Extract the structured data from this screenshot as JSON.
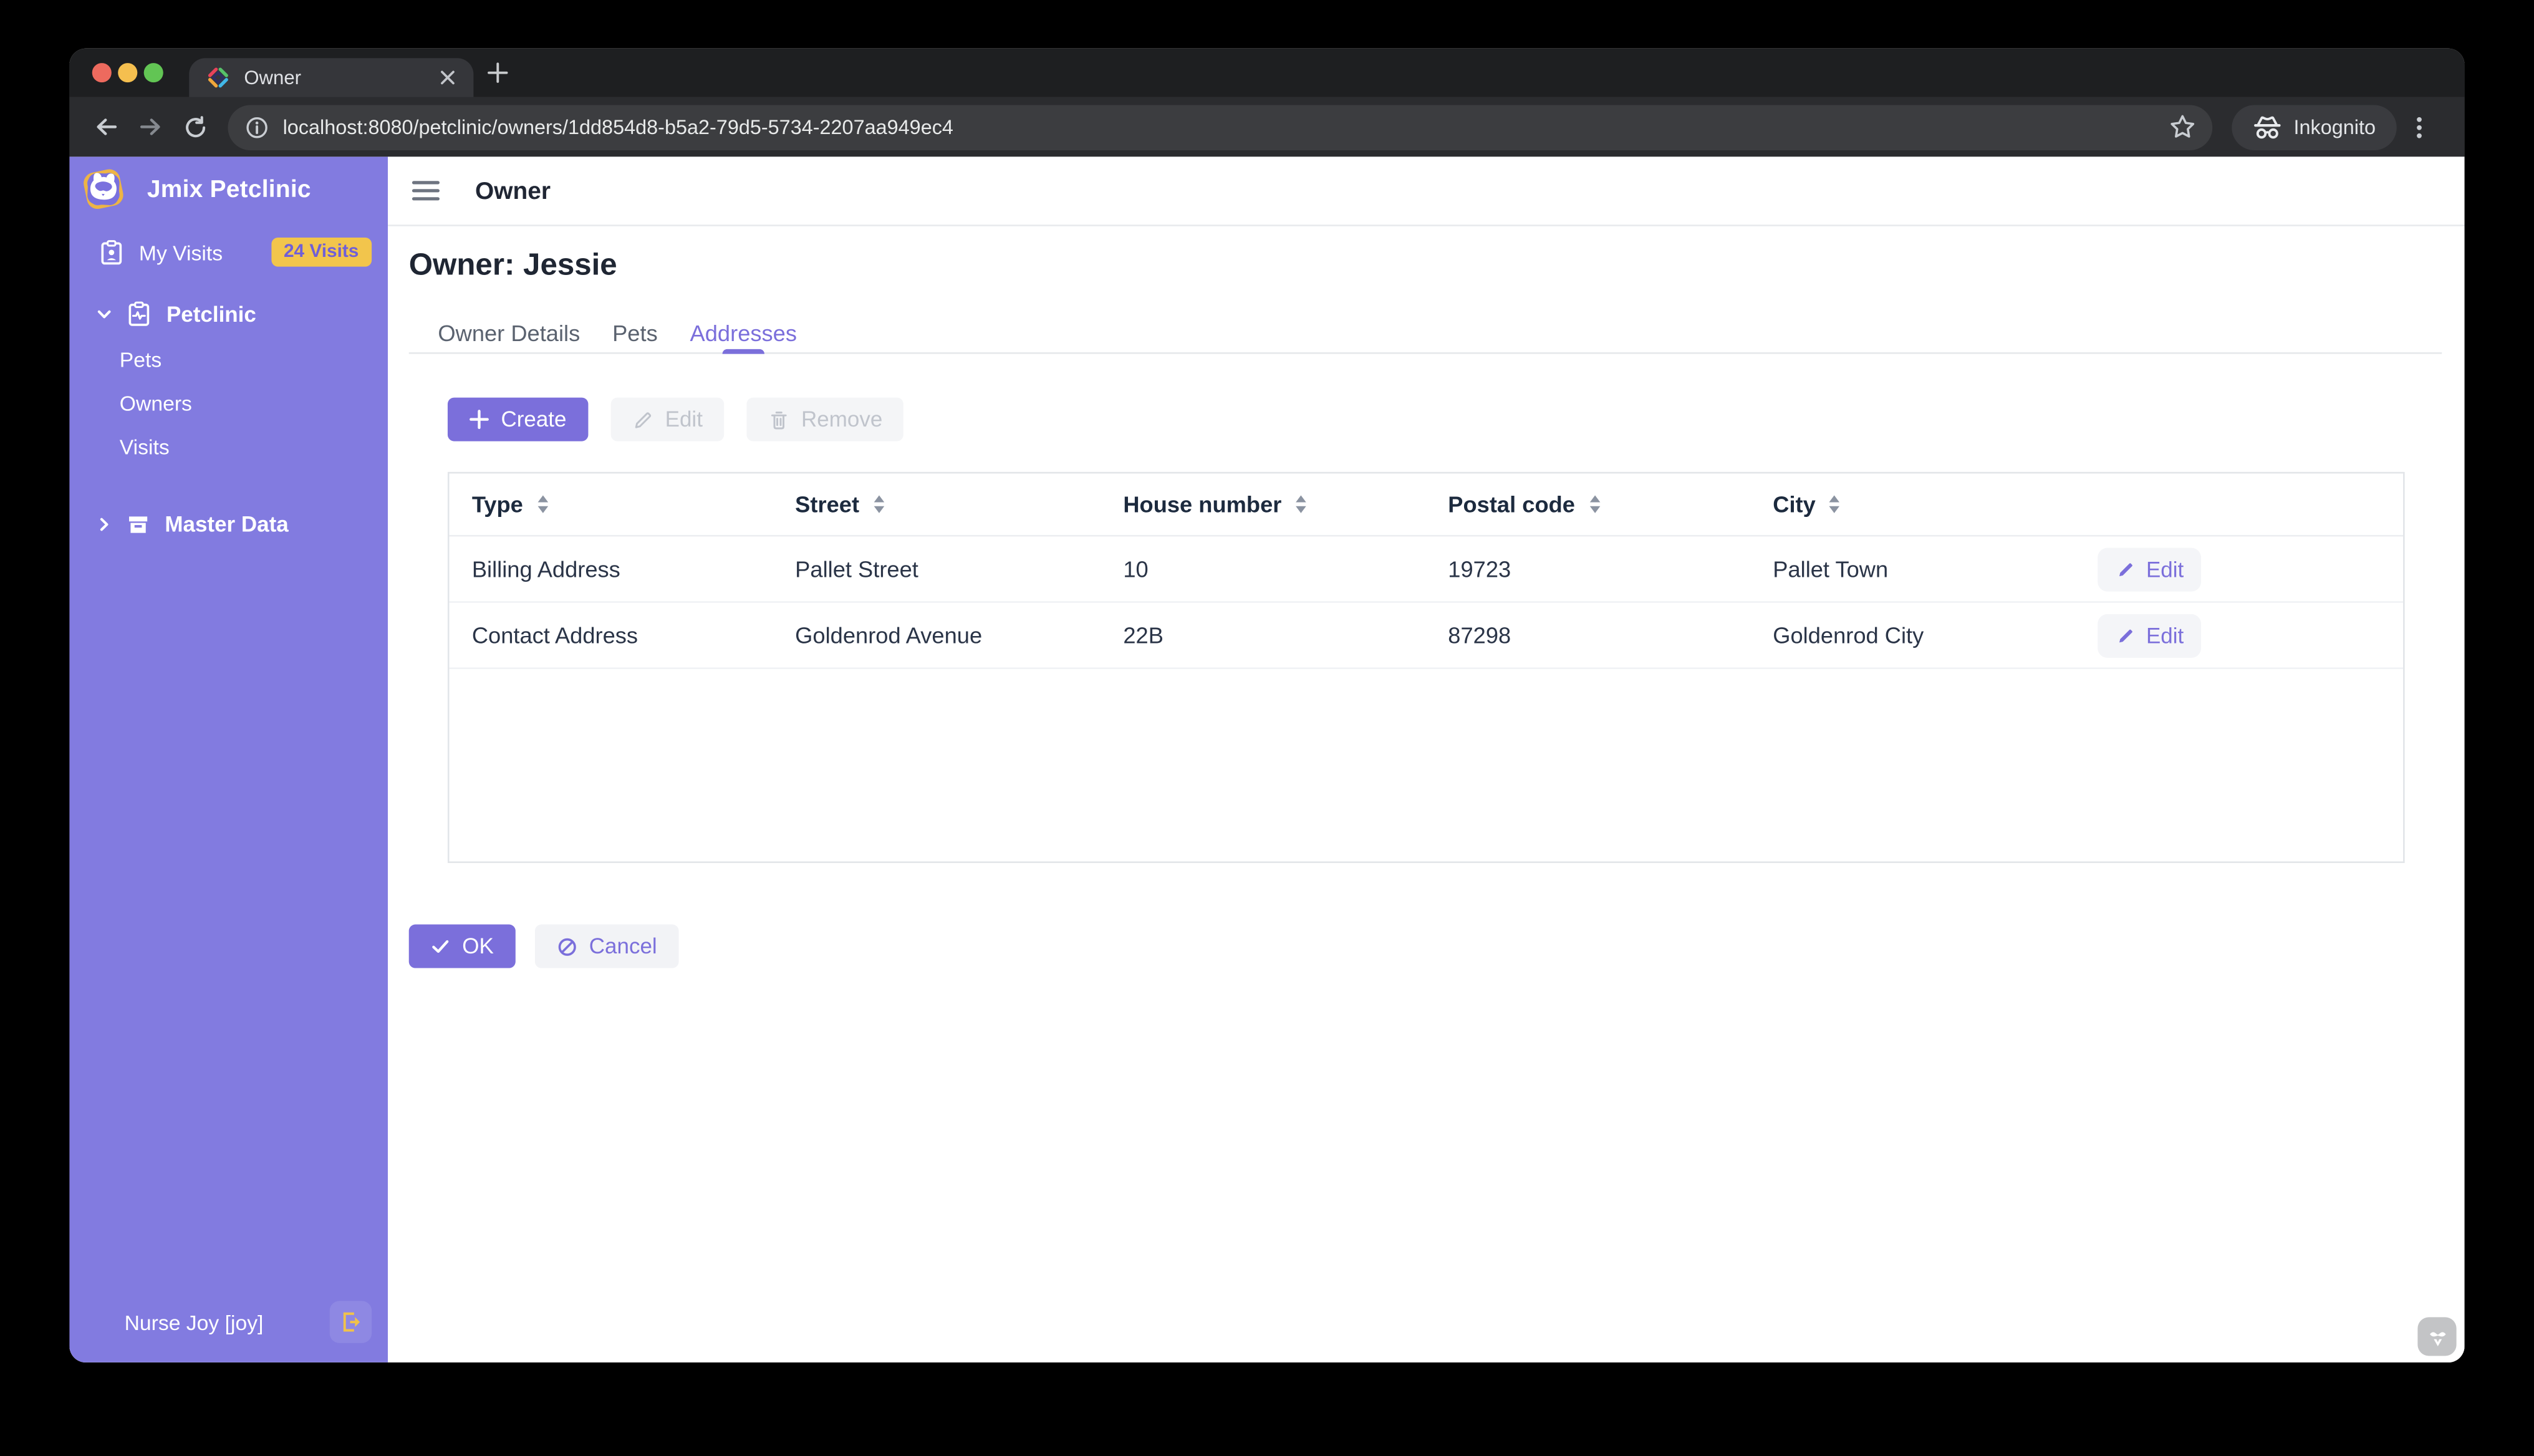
{
  "browser": {
    "tab_title": "Owner",
    "url": "localhost:8080/petclinic/owners/1dd854d8-b5a2-79d5-5734-2207aa949ec4",
    "incognito_label": "Inkognito"
  },
  "sidebar": {
    "app_title": "Jmix Petclinic",
    "my_visits_label": "My Visits",
    "my_visits_badge": "24 Visits",
    "petclinic_label": "Petclinic",
    "items": [
      {
        "label": "Pets"
      },
      {
        "label": "Owners"
      },
      {
        "label": "Visits"
      }
    ],
    "master_data_label": "Master Data",
    "user_name": "Nurse Joy [joy]"
  },
  "header": {
    "app_bar_title": "Owner",
    "page_title": "Owner: Jessie"
  },
  "tabs": {
    "items": [
      {
        "label": "Owner Details"
      },
      {
        "label": "Pets"
      },
      {
        "label": "Addresses"
      }
    ]
  },
  "actions_toolbar": {
    "create_label": "Create",
    "edit_label": "Edit",
    "remove_label": "Remove"
  },
  "table": {
    "columns": [
      "Type",
      "Street",
      "House number",
      "Postal code",
      "City"
    ],
    "rows": [
      {
        "type": "Billing Address",
        "street": "Pallet Street",
        "house_number": "10",
        "postal_code": "19723",
        "city": "Pallet Town",
        "action": "Edit"
      },
      {
        "type": "Contact Address",
        "street": "Goldenrod Avenue",
        "house_number": "22B",
        "postal_code": "87298",
        "city": "Goldenrod City",
        "action": "Edit"
      }
    ]
  },
  "footer_actions": {
    "ok_label": "OK",
    "cancel_label": "Cancel"
  },
  "colors": {
    "primary": "#7B6FDB",
    "sidebar": "#827BE0",
    "badge_bg": "#F2C54C",
    "badge_text": "#6F5FD8",
    "accent_yellow": "#F0C24B"
  }
}
